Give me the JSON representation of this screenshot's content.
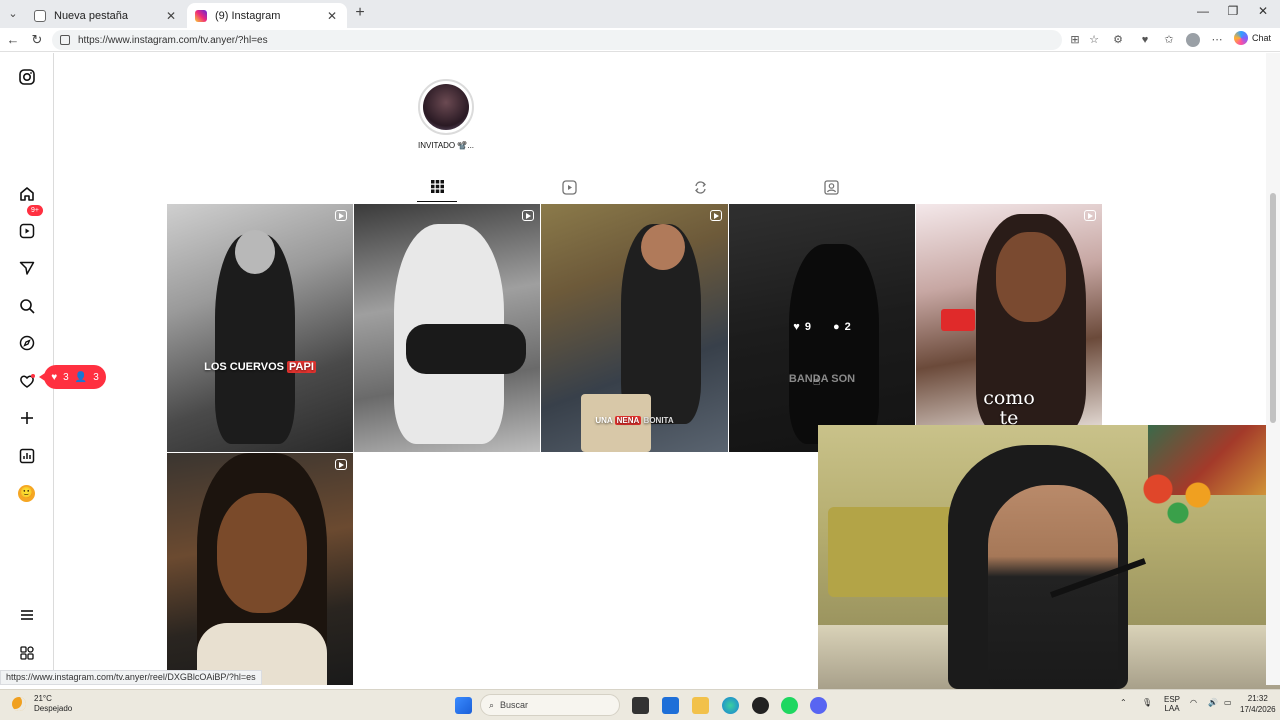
{
  "browser": {
    "tabs": [
      {
        "label": "Nueva pestaña",
        "active": false
      },
      {
        "label": "(9) Instagram",
        "active": true
      }
    ],
    "url": "https://www.instagram.com/tv.anyer/?hl=es",
    "chat_label": "Chat"
  },
  "sidebar": {
    "notifications_badge": "9+",
    "activity_pill": {
      "likes": "3",
      "follows": "3"
    }
  },
  "profile": {
    "story_label": "INVITADO 📽️..."
  },
  "grid": {
    "tile1_caption_pre": "LOS CUERVOS ",
    "tile1_caption_hl": "PAPI",
    "tile3_caption_pre": "UNA ",
    "tile3_caption_hl": "NENA",
    "tile3_caption_post": " BONITA",
    "tile4_caption": "BANDA SON",
    "tile4_likes": "9",
    "tile4_comments": "2",
    "tile5_caption_1": "como",
    "tile5_caption_2": "te"
  },
  "status_link": "https://www.instagram.com/tv.anyer/reel/DXGBlcOAiBP/?hl=es",
  "taskbar": {
    "temperature": "21°C",
    "weather": "Despejado",
    "search_placeholder": "Buscar",
    "lang_1": "ESP",
    "lang_2": "LAA",
    "time": "21:32",
    "date": "17/4/2026"
  },
  "colors": {
    "instagram_red": "#ff3040",
    "caption_highlight": "#e0322e"
  }
}
